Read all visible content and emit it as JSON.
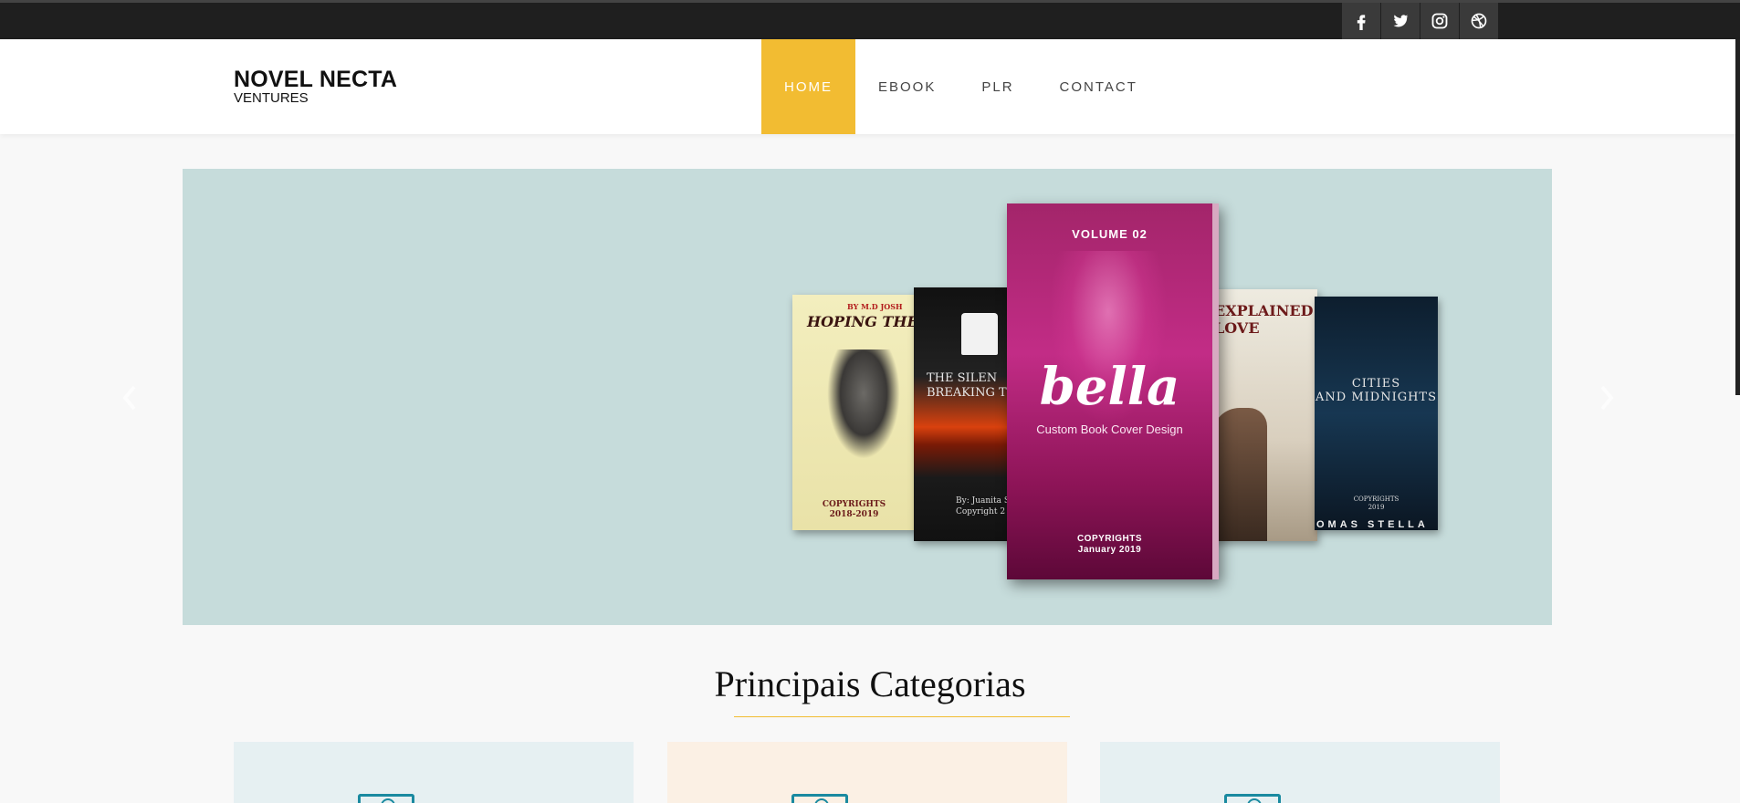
{
  "social": {
    "items": [
      {
        "name": "facebook-icon"
      },
      {
        "name": "twitter-icon"
      },
      {
        "name": "instagram-icon"
      },
      {
        "name": "dribbble-icon"
      }
    ]
  },
  "brand": {
    "name": "NOVEL NECTA",
    "sub": "VENTURES"
  },
  "nav": {
    "items": [
      {
        "label": "HOME",
        "active": true
      },
      {
        "label": "EBOOK",
        "active": false
      },
      {
        "label": "PLR",
        "active": false
      },
      {
        "label": "CONTACT",
        "active": false
      }
    ]
  },
  "slider": {
    "books": {
      "b1": {
        "author": "BY M.D JOSH",
        "title": "HOPING THE BE",
        "copy": "COPYRIGHTS\n2018-2019"
      },
      "b2": {
        "title": "THE SILEN\nBREAKING TH",
        "author": "By: Juanita S\nCopyright 2"
      },
      "b3": {
        "title": "EXPLAINED\nLOVE"
      },
      "b4": {
        "title": "CITIES\nAND MIDNIGHTS",
        "copy": "COPYRIGHTS\n2019",
        "author": "OMAS STELLA"
      },
      "b5": {
        "volume": "VOLUME 02",
        "title": "bella",
        "subtitle": "Custom Book Cover Design",
        "copy": "COPYRIGHTS\nJanuary 2019"
      }
    }
  },
  "section": {
    "title": "Principais Categorias"
  },
  "colors": {
    "accent": "#f2bc32",
    "topbar": "#1f1f1f",
    "slider_bg": "#c6dcdb"
  }
}
